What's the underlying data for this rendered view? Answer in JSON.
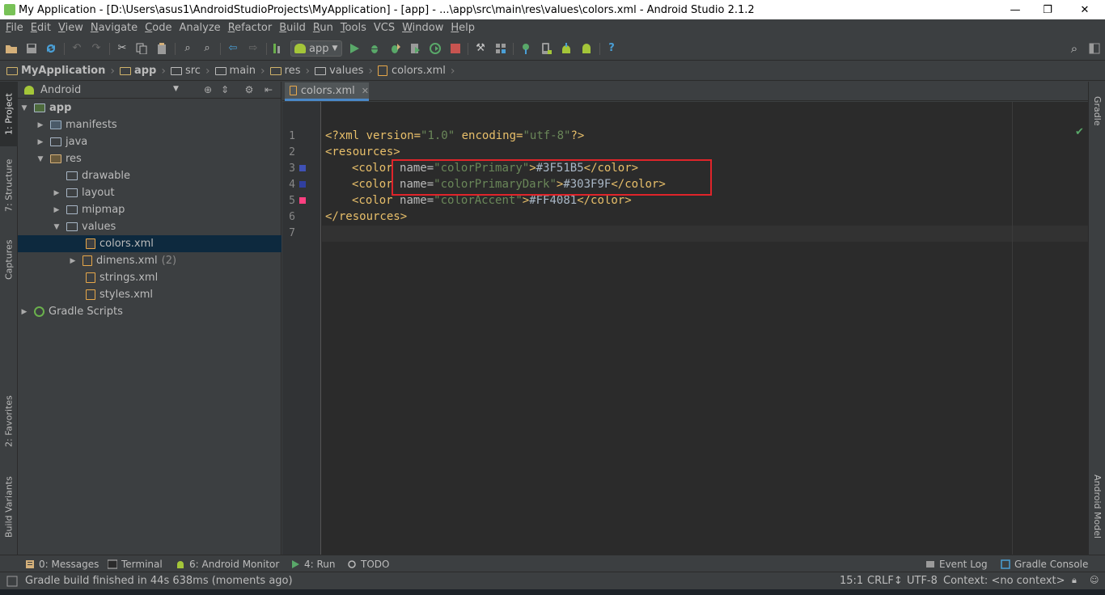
{
  "window": {
    "title": "My Application - [D:\\Users\\asus1\\AndroidStudioProjects\\MyApplication] - [app] - ...\\app\\src\\main\\res\\values\\colors.xml - Android Studio 2.1.2",
    "minimize_glyph": "—",
    "restore_glyph": "❐",
    "close_glyph": "✕"
  },
  "menu": {
    "items": [
      {
        "u": "F",
        "rest": "ile"
      },
      {
        "u": "E",
        "rest": "dit"
      },
      {
        "u": "V",
        "rest": "iew"
      },
      {
        "u": "N",
        "rest": "avigate"
      },
      {
        "u": "C",
        "rest": "ode"
      },
      {
        "u": "",
        "rest": "Analyze"
      },
      {
        "u": "R",
        "rest": "efactor"
      },
      {
        "u": "B",
        "rest": "uild"
      },
      {
        "u": "R",
        "rest": "un"
      },
      {
        "u": "T",
        "rest": "ools"
      },
      {
        "u": "",
        "rest": "VCS"
      },
      {
        "u": "W",
        "rest": "indow"
      },
      {
        "u": "H",
        "rest": "elp"
      }
    ]
  },
  "toolbar": {
    "run_config": "app",
    "help_glyph": "?",
    "search_glyph": "⚲"
  },
  "breadcrumb": [
    "MyApplication",
    "app",
    "src",
    "main",
    "res",
    "values",
    "colors.xml"
  ],
  "left_tabs": {
    "project": "1: Project",
    "structure": "7: Structure",
    "captures": "Captures",
    "favorites": "2: Favorites",
    "build_variants": "Build Variants"
  },
  "right_tabs": {
    "gradle": "Gradle",
    "android_model": "Android Model"
  },
  "project_panel": {
    "view": "Android",
    "tree": [
      {
        "label": "app",
        "count": ""
      },
      {
        "label": "manifests",
        "count": ""
      },
      {
        "label": "java",
        "count": ""
      },
      {
        "label": "res",
        "count": ""
      },
      {
        "label": "drawable",
        "count": ""
      },
      {
        "label": "layout",
        "count": ""
      },
      {
        "label": "mipmap",
        "count": ""
      },
      {
        "label": "values",
        "count": ""
      },
      {
        "label": "colors.xml",
        "count": ""
      },
      {
        "label": "dimens.xml",
        "count": "(2)"
      },
      {
        "label": "strings.xml",
        "count": ""
      },
      {
        "label": "styles.xml",
        "count": ""
      },
      {
        "label": "Gradle Scripts",
        "count": ""
      }
    ]
  },
  "editor": {
    "tab_label": "colors.xml",
    "line_numbers": [
      "1",
      "2",
      "3",
      "4",
      "5",
      "6",
      "7"
    ],
    "swatch_colors": {
      "primary": "#3F51B5",
      "primary_dark": "#303F9F",
      "accent": "#FF4081"
    },
    "code": {
      "l1": {
        "a": "<?xml version=",
        "b": "\"1.0\"",
        "c": " encoding=",
        "d": "\"utf-8\"",
        "e": "?>"
      },
      "l2": {
        "a": "<resources>"
      },
      "l3": {
        "a": "<color ",
        "b": "name=",
        "c": "\"colorPrimary\"",
        "d": ">",
        "e": "#3F51B5",
        "f": "</color>"
      },
      "l4": {
        "a": "<color ",
        "b": "name=",
        "c": "\"colorPrimaryDark\"",
        "d": ">",
        "e": "#303F9F",
        "f": "</color>"
      },
      "l5": {
        "a": "<color ",
        "b": "name=",
        "c": "\"colorAccent\"",
        "d": ">",
        "e": "#FF4081",
        "f": "</color>"
      },
      "l6": {
        "a": "</resources>"
      },
      "l7": {
        "a": ""
      }
    },
    "highlight_color": "#e0242a"
  },
  "bottom_tabs": {
    "messages": "0: Messages",
    "terminal": "Terminal",
    "android_monitor": "6: Android Monitor",
    "run": "4: Run",
    "todo": "TODO",
    "event_log": "Event Log",
    "gradle_console": "Gradle Console"
  },
  "status": {
    "message": "Gradle build finished in 44s 638ms (moments ago)",
    "position": "15:1",
    "line_sep": "CRLF↕",
    "encoding": "UTF-8",
    "context": "Context: <no context>"
  }
}
